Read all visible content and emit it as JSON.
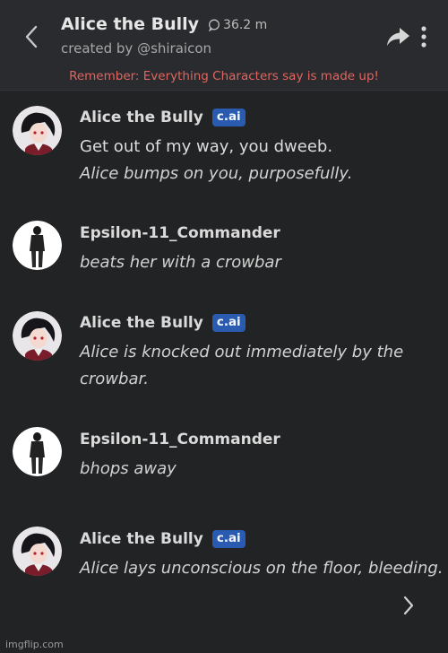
{
  "header": {
    "title": "Alice the Bully",
    "interactions_count": "36.2 m",
    "created_by": "created by @shiraicon",
    "disclaimer": "Remember: Everything Characters say is made up!"
  },
  "messages": [
    {
      "author": "Alice the Bully",
      "badge": "c.ai",
      "avatar": "anime-girl-avatar",
      "lines": [
        "Get out of my way, you dweeb.",
        "Alice bumps on you, purposefully."
      ]
    },
    {
      "author": "Epsilon-11_Commander",
      "badge": "",
      "avatar": "soldier-avatar",
      "lines": [
        "beats her with a crowbar"
      ]
    },
    {
      "author": "Alice the Bully",
      "badge": "c.ai",
      "avatar": "anime-girl-avatar",
      "lines": [
        "Alice is knocked out immediately by the",
        "crowbar."
      ]
    },
    {
      "author": "Epsilon-11_Commander",
      "badge": "",
      "avatar": "soldier-avatar",
      "lines": [
        "bhops away"
      ]
    },
    {
      "author": "Alice the Bully",
      "badge": "c.ai",
      "avatar": "anime-girl-avatar",
      "lines": [
        "Alice lays unconscious on the floor, bleeding."
      ]
    }
  ],
  "watermark": "imgflip.com",
  "colors": {
    "badge": "#2b5bb0",
    "disclaimer": "#e0655f",
    "background": "#222325"
  }
}
